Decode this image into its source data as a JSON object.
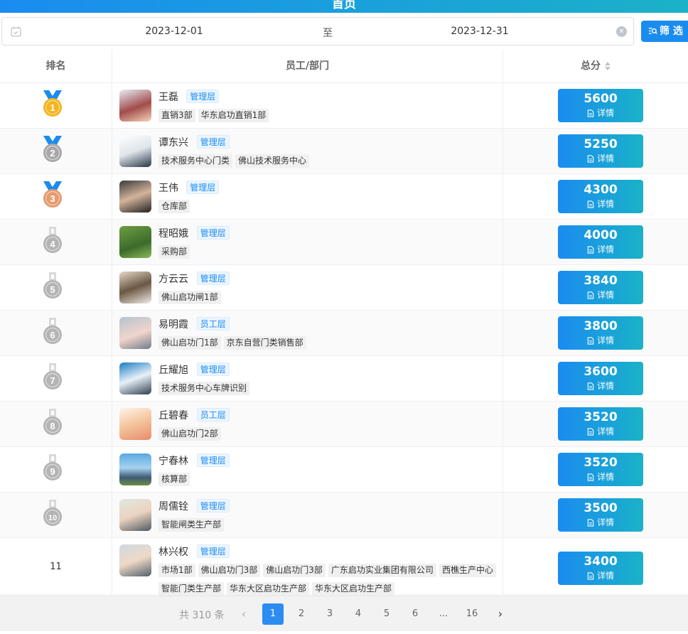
{
  "header": {
    "title": "首页"
  },
  "filter": {
    "start_date": "2023-12-01",
    "separator": "至",
    "end_date": "2023-12-31",
    "button_label": "筛 选"
  },
  "table": {
    "columns": {
      "rank": "排名",
      "employee": "员工/部门",
      "score": "总分"
    },
    "detail_label": "详情",
    "rows": [
      {
        "rank": "1",
        "name": "王磊",
        "role": "管理层",
        "tags": [
          "直销3部",
          "华东启功直销1部"
        ],
        "score": "5600"
      },
      {
        "rank": "2",
        "name": "谭东兴",
        "role": "管理层",
        "tags": [
          "技术服务中心门类",
          "佛山技术服务中心"
        ],
        "score": "5250"
      },
      {
        "rank": "3",
        "name": "王伟",
        "role": "管理层",
        "tags": [
          "仓库部"
        ],
        "score": "4300"
      },
      {
        "rank": "4",
        "name": "程昭娥",
        "role": "管理层",
        "tags": [
          "采购部"
        ],
        "score": "4000"
      },
      {
        "rank": "5",
        "name": "方云云",
        "role": "管理层",
        "tags": [
          "佛山启功闸1部"
        ],
        "score": "3840"
      },
      {
        "rank": "6",
        "name": "易明霞",
        "role": "员工层",
        "tags": [
          "佛山启功门1部",
          "京东自营门类销售部"
        ],
        "score": "3800"
      },
      {
        "rank": "7",
        "name": "丘耀旭",
        "role": "管理层",
        "tags": [
          "技术服务中心车牌识别"
        ],
        "score": "3600"
      },
      {
        "rank": "8",
        "name": "丘碧春",
        "role": "员工层",
        "tags": [
          "佛山启功门2部"
        ],
        "score": "3520"
      },
      {
        "rank": "9",
        "name": "宁春林",
        "role": "管理层",
        "tags": [
          "核算部"
        ],
        "score": "3520"
      },
      {
        "rank": "10",
        "name": "周儒铨",
        "role": "管理层",
        "tags": [
          "智能闸类生产部"
        ],
        "score": "3500"
      },
      {
        "rank": "11",
        "name": "林兴权",
        "role": "管理层",
        "tags": [
          "市场1部",
          "佛山启功门3部",
          "佛山启功门3部",
          "广东启功实业集团有限公司",
          "西樵生产中心",
          "智能门类生产部",
          "华东大区启功生产部",
          "华东大区启功生产部"
        ],
        "score": "3400"
      }
    ]
  },
  "pagination": {
    "total": "共 310 条",
    "pages": [
      "1",
      "2",
      "3",
      "4",
      "5",
      "6",
      "...",
      "16"
    ],
    "current": "1",
    "prev_icon": "‹",
    "next_icon": "›"
  },
  "colors": {
    "accent": "#1a8cf0",
    "accent2": "#1ab2c8",
    "gold": "#f5b41e",
    "silver": "#a8a8a8",
    "bronze": "#e59a6c",
    "gray": "#b4b4b4"
  },
  "icons": {
    "calendar": "calendar-check-icon",
    "clear": "circle-close-icon",
    "filter": "search-filter-icon",
    "detail": "document-icon",
    "sort": "sort-caret-icon",
    "medal": "medal-icon"
  }
}
